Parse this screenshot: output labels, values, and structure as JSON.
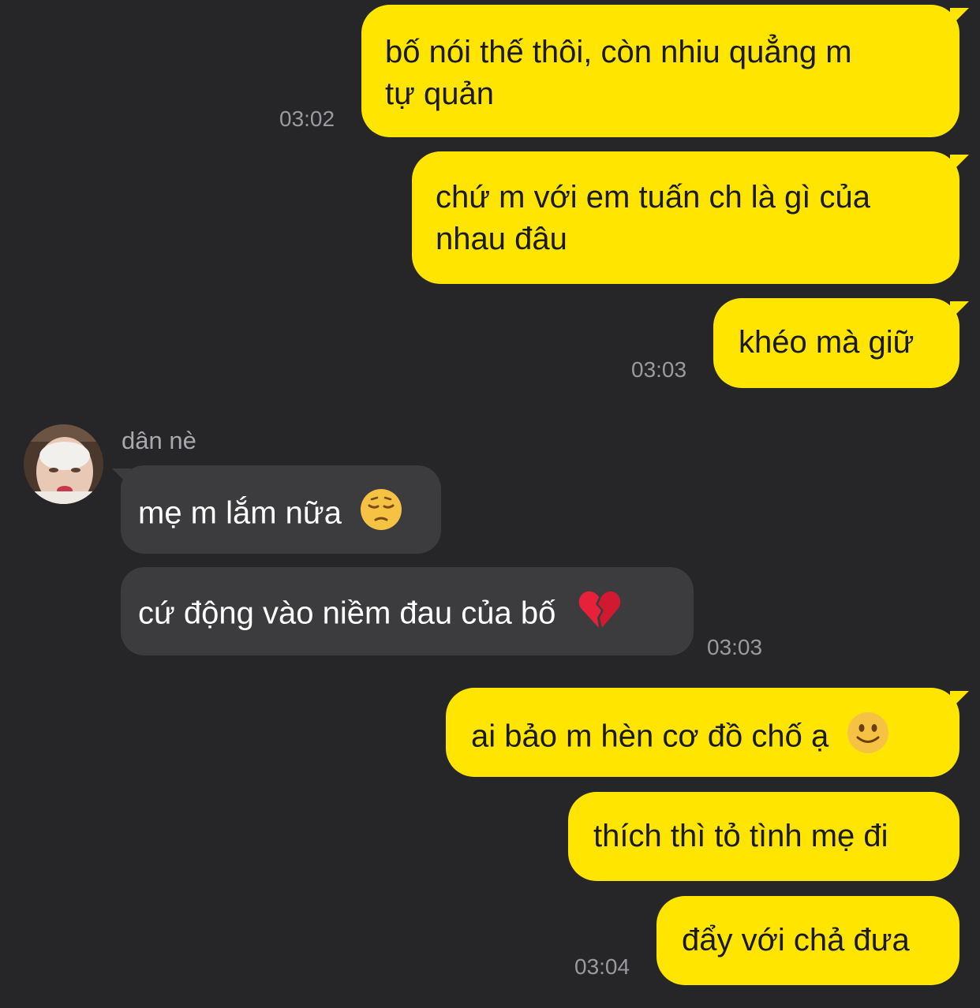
{
  "chat": {
    "messages": [
      {
        "id": "m1",
        "text_line1": "bố nói thế thôi, còn nhiu quẳng m",
        "text_line2": "tự quản"
      },
      {
        "id": "m2",
        "text_line1": "chứ m với em tuấn ch là gì của",
        "text_line2": "nhau đâu"
      },
      {
        "id": "m3",
        "text": "khéo mà giữ"
      },
      {
        "id": "m4",
        "text": "mẹ m lắm nữa"
      },
      {
        "id": "m5",
        "text": "cứ động vào niềm đau của bố"
      },
      {
        "id": "m6",
        "text": "ai bảo m hèn cơ đồ chố ạ"
      },
      {
        "id": "m7",
        "text": "thích thì tỏ tình mẹ đi"
      },
      {
        "id": "m8",
        "text": "đẩy với chả đưa"
      }
    ],
    "timestamps": {
      "t1": "03:02",
      "t2": "03:03",
      "t3": "03:03",
      "t4": "03:04"
    },
    "sender_name": "dân nè",
    "icons": {
      "pensive": "pensive-face-emoji",
      "broken_heart": "broken-heart-emoji",
      "smile": "slightly-smiling-face-emoji"
    },
    "colors": {
      "background": "#262628",
      "outgoing_bubble": "#ffe500",
      "incoming_bubble": "#3c3c3e",
      "timestamp": "#9a9a9e"
    }
  }
}
